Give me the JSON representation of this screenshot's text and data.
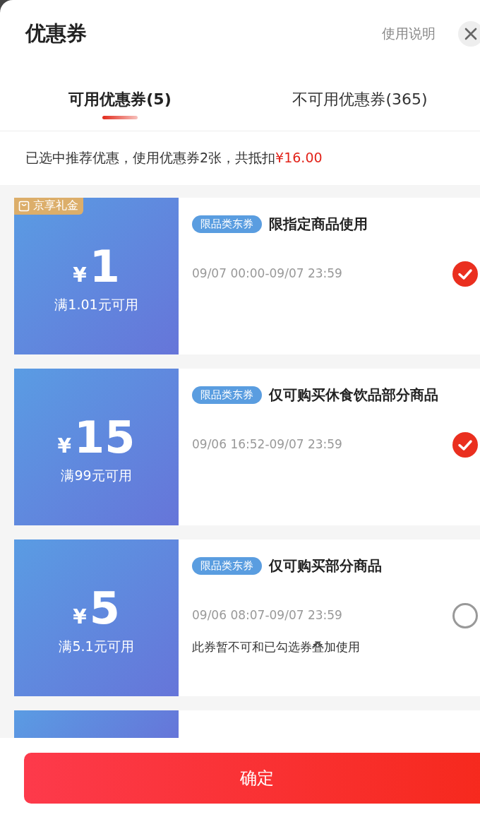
{
  "header": {
    "title": "优惠券",
    "help_link": "使用说明"
  },
  "tabs": [
    {
      "label": "可用优惠券(5)",
      "selected": true
    },
    {
      "label": "不可用优惠券(365)",
      "selected": false
    }
  ],
  "summary": {
    "text": "已选中推荐优惠，使用优惠券2张，共抵扣",
    "amount": "¥16.00"
  },
  "coupons": [
    {
      "kind": "full",
      "badge": "京享礼金",
      "currency": "¥",
      "amount": "1",
      "condition": "满1.01元可用",
      "tag": "限品类东券",
      "title": "限指定商品使用",
      "time": "09/07 00:00-09/07 23:59",
      "selected": true
    },
    {
      "kind": "full",
      "currency": "¥",
      "amount": "15",
      "condition": "满99元可用",
      "tag": "限品类东券",
      "title": "仅可购买休食饮品部分商品",
      "time": "09/06 16:52-09/07 23:59",
      "selected": true
    },
    {
      "kind": "full",
      "currency": "¥",
      "amount": "5",
      "condition": "满5.1元可用",
      "tag": "限品类东券",
      "title": "仅可购买部分商品",
      "time": "09/06 08:07-09/07 23:59",
      "note": "此券暂不可和已勾选券叠加使用",
      "selected": false
    },
    {
      "kind": "cut"
    }
  ],
  "confirm_button": "确定"
}
